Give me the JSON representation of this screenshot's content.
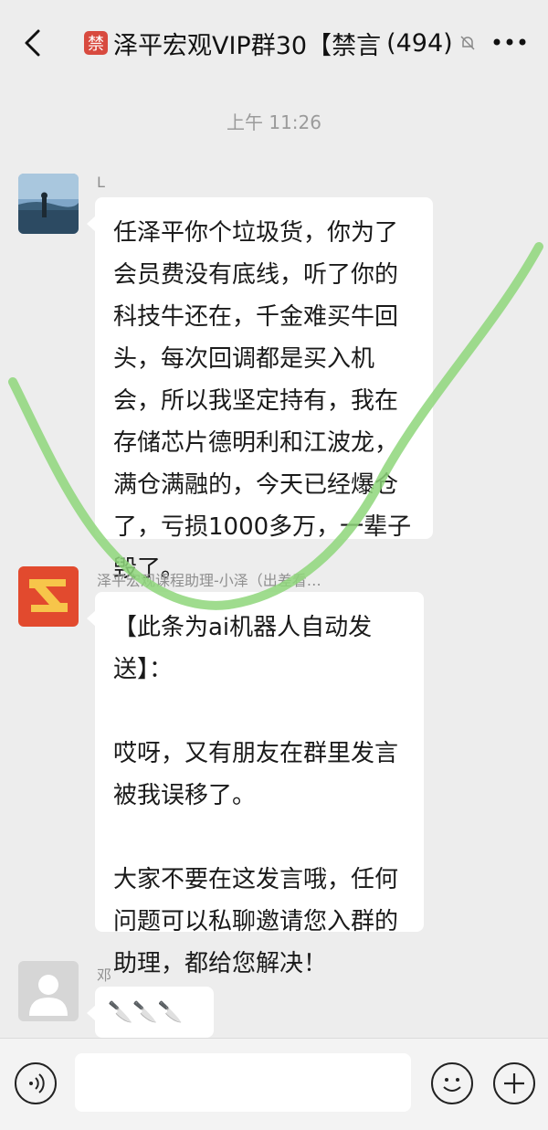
{
  "header": {
    "badge": "禁",
    "title": "泽平宏观VIP群30【禁言",
    "member_count": "(494)"
  },
  "timestamp": "上午 11:26",
  "messages": [
    {
      "sender": "L",
      "lines": [
        "任泽平你个垃圾货，你为了",
        "会员费没有底线，听了你的",
        "科技牛还在，千金难买牛回",
        "头，每次回调都是买入机",
        "会，所以我坚定持有，我在",
        "存储芯片德明利和江波龙，",
        "满仓满融的，今天已经爆仓",
        "了，亏损1000多万，一辈子",
        "毁了。"
      ]
    },
    {
      "sender": "泽平宏观课程助理-小泽（出差看…",
      "paragraphs": [
        [
          "【此条为ai机器人自动发",
          "送】："
        ],
        [
          "哎呀，又有朋友在群里发言",
          "被我误移了。"
        ],
        [
          "大家不要在这发言哦，任何",
          "问题可以私聊邀请您入群的",
          "助理，都给您解决！"
        ]
      ]
    },
    {
      "sender": "邓",
      "text": "🔪🔪🔪"
    }
  ],
  "colors": {
    "background": "#ededed",
    "bubble": "#ffffff",
    "badge": "#d84a3f",
    "highlight_stroke": "#8ed67a"
  }
}
